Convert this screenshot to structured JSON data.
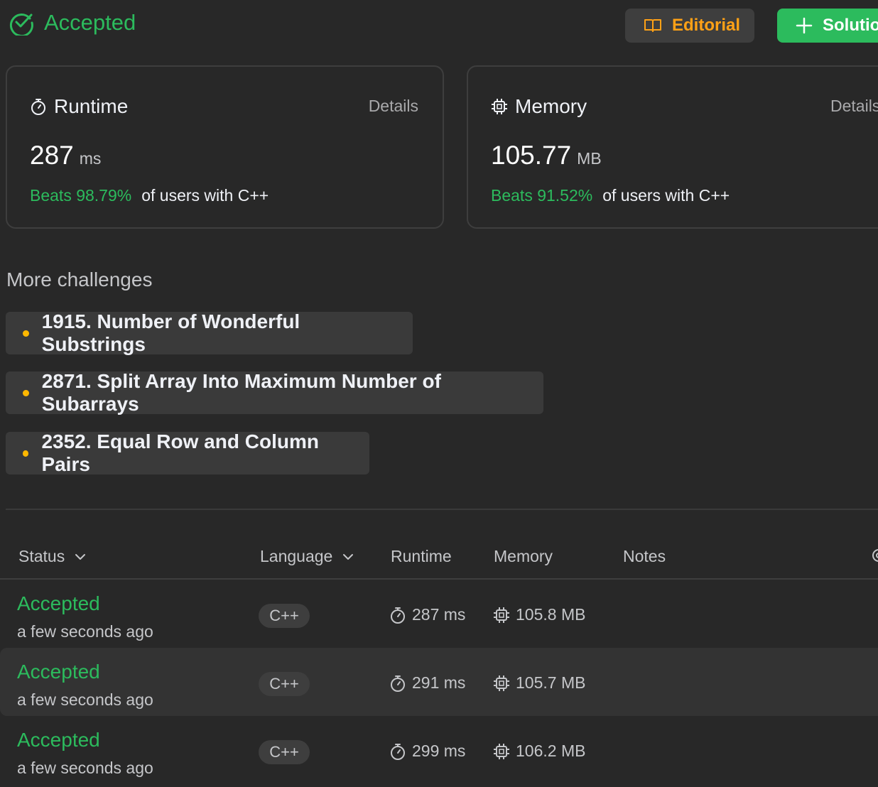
{
  "header": {
    "status": "Accepted",
    "editorial_label": "Editorial",
    "solution_label": "Solutio"
  },
  "runtime_card": {
    "title": "Runtime",
    "details_label": "Details",
    "value": "287",
    "unit": "ms",
    "beats": "Beats 98.79%",
    "beats_suffix": "of users with C++"
  },
  "memory_card": {
    "title": "Memory",
    "details_label": "Details",
    "value": "105.77",
    "unit": "MB",
    "beats": "Beats 91.52%",
    "beats_suffix": "of users with C++"
  },
  "more_challenges": {
    "title": "More challenges",
    "items": [
      {
        "label": "1915. Number of Wonderful Substrings"
      },
      {
        "label": "2871. Split Array Into Maximum Number of Subarrays"
      },
      {
        "label": "2352. Equal Row and Column Pairs"
      }
    ]
  },
  "table": {
    "headers": {
      "status": "Status",
      "language": "Language",
      "runtime": "Runtime",
      "memory": "Memory",
      "notes": "Notes"
    },
    "rows": [
      {
        "status": "Accepted",
        "time": "a few seconds ago",
        "language": "C++",
        "runtime": "287 ms",
        "memory": "105.8 MB"
      },
      {
        "status": "Accepted",
        "time": "a few seconds ago",
        "language": "C++",
        "runtime": "291 ms",
        "memory": "105.7 MB"
      },
      {
        "status": "Accepted",
        "time": "a few seconds ago",
        "language": "C++",
        "runtime": "299 ms",
        "memory": "106.2 MB"
      }
    ]
  },
  "colors": {
    "accent_green": "#2cbb5d",
    "accent_orange": "#ffa116",
    "dot_yellow": "#ffb800",
    "background": "#282828"
  },
  "icons": [
    "check-circle-icon",
    "book-icon",
    "plus-icon",
    "stopwatch-icon",
    "chip-icon",
    "chevron-down-icon",
    "gear-icon"
  ]
}
